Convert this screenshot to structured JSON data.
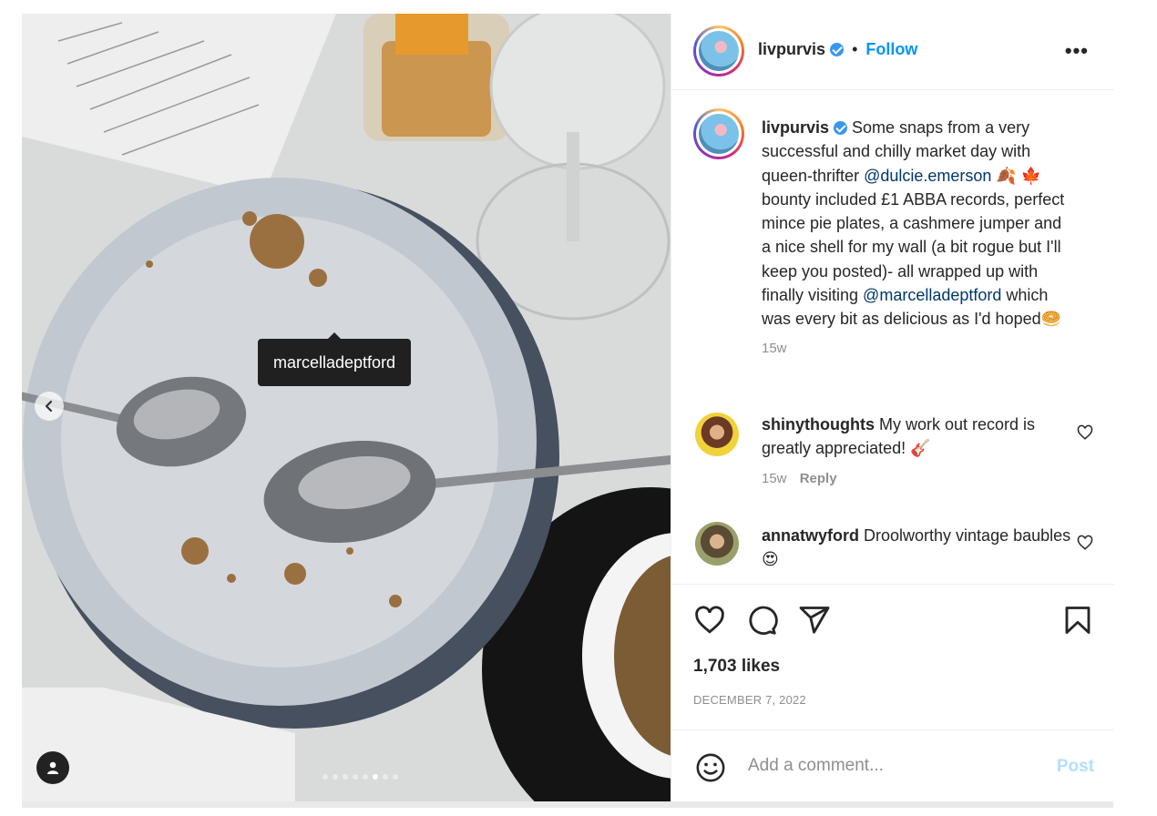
{
  "post": {
    "username": "livpurvis",
    "separator": "•",
    "follow_label": "Follow",
    "more_label": "•••",
    "photo_tag": "marcelladeptford",
    "caption": {
      "username": "livpurvis",
      "text_1": " Some snaps from a very successful and chilly market day with queen-thrifter ",
      "mention_1": "@dulcie.emerson",
      "text_2": " 🍂 🍁 bounty included £1 ABBA records, perfect mince pie plates, a cashmere jumper and a nice shell for my wall (a bit rogue but I'll keep you posted)- all wrapped up with finally visiting ",
      "mention_2": "@marcelladeptford",
      "text_3": " which was every bit as delicious as I'd hoped🥯",
      "age": "15w"
    },
    "comments": [
      {
        "username": "shinythoughts",
        "text": " My work out record is greatly appreciated! 🎸",
        "age": "15w",
        "reply_label": "Reply"
      },
      {
        "username": "annatwyford",
        "text": " Droolworthy vintage baubles 😍"
      }
    ],
    "likes": "1,703 likes",
    "date": "DECEMBER 7, 2022",
    "comment_placeholder": "Add a comment...",
    "post_label": "Post",
    "icons": [
      "heart-icon",
      "comment-icon",
      "share-icon",
      "bookmark-icon",
      "emoji-icon",
      "user-tag-icon",
      "chevron-left-icon",
      "more-icon"
    ],
    "carousel_dots": 8,
    "carousel_active": 6,
    "colors": {
      "follow": "#0095f6",
      "mention": "#00376b",
      "meta": "#8e8e8e",
      "post_disabled": "#b2dffc",
      "verified": "#3797f0"
    }
  }
}
